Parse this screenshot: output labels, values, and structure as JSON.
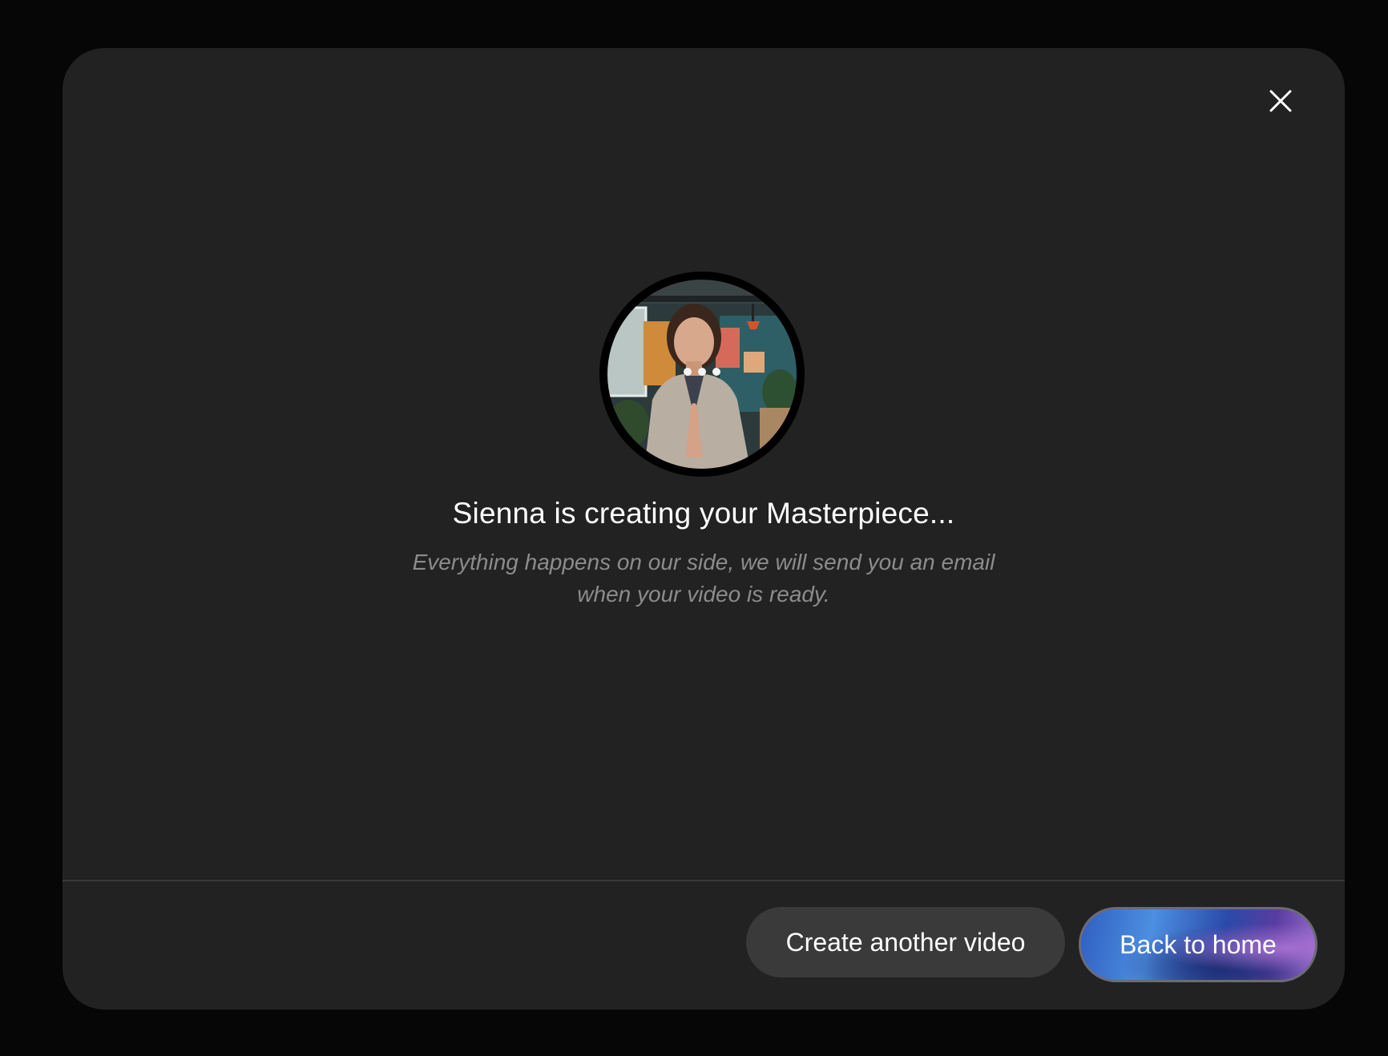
{
  "modal": {
    "close_icon": "close-icon",
    "avatar": {
      "icon": "avatar-photo",
      "loading_dots": 3
    },
    "title": "Sienna is creating your Masterpiece...",
    "subtitle": "Everything happens on our side, we will send you an email when your video is ready."
  },
  "footer": {
    "secondary_label": "Create another video",
    "primary_label": "Back to home"
  },
  "colors": {
    "modal_bg": "#222222",
    "backdrop": "#060606",
    "secondary_button": "#3a3a3a",
    "subtitle_text": "#8c8c8c",
    "primary_gradient_start": "#2f5fc2",
    "primary_gradient_end": "#9a6fd0"
  }
}
